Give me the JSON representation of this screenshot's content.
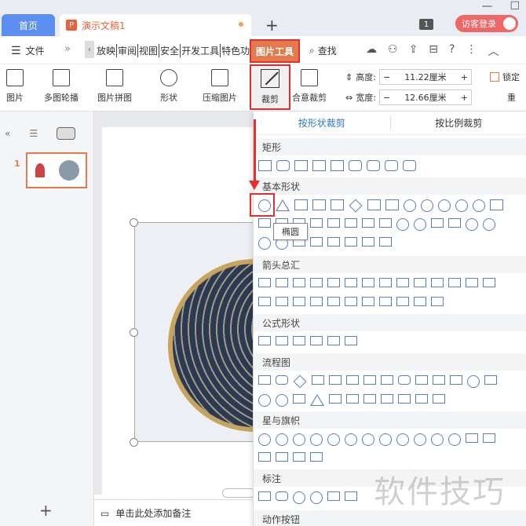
{
  "tabs": {
    "home": "首页",
    "doc_title": "演示文稿1",
    "new_tab": "+",
    "badge": "1",
    "guest": "访客登录"
  },
  "menu": {
    "file": "文件",
    "more": "»",
    "items": [
      "放映",
      "审阅",
      "视图",
      "安全",
      "开发工具",
      "特色功能"
    ],
    "picture_tools": "图片工具",
    "find": "查找"
  },
  "ribbon": {
    "picture": "图片",
    "multi_carousel": "多图轮播",
    "collage": "图片拼图",
    "shape": "形状",
    "compress": "压缩图片",
    "crop": "裁剪",
    "free_crop": "合意裁剪",
    "height_label": "高度:",
    "height_value": "11.22厘米",
    "width_label": "宽度:",
    "width_value": "12.66厘米",
    "lock": "锁定",
    "reset": "重"
  },
  "left_panel": {
    "slide_number": "1",
    "add": "+"
  },
  "notes": {
    "placeholder": "单击此处添加备注"
  },
  "dropdown": {
    "tab_shape": "按形状裁剪",
    "tab_ratio": "按比例裁剪",
    "categories": [
      "矩形",
      "基本形状",
      "箭头总汇",
      "公式形状",
      "流程图",
      "星与旗帜",
      "标注",
      "动作按钮"
    ],
    "tooltip": "椭圆"
  },
  "watermark": "软件技巧",
  "colors": {
    "accent": "#e47a4c",
    "highlight": "#e03030",
    "home_tab": "#5d8ff0",
    "shape_stroke": "#5a7fbf"
  }
}
